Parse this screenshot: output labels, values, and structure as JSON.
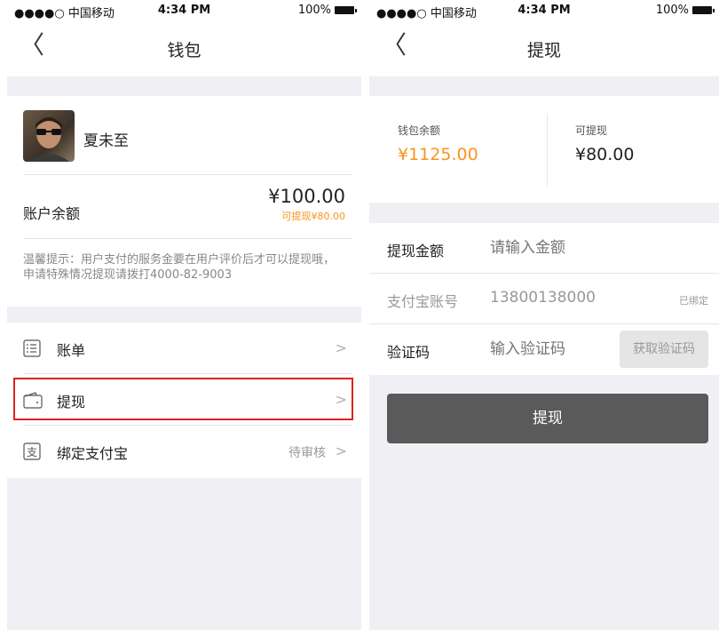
{
  "status": {
    "carrier": "●●●●○ 中国移动",
    "time": "4:34 PM",
    "battery": "100%"
  },
  "wallet": {
    "back": "〈",
    "title": "钱包",
    "user_name": "夏未至",
    "balance_label": "账户余额",
    "balance_value": "¥100.00",
    "withdrawable": "可提现¥80.00",
    "notice": "温馨提示：用户支付的服务金要在用户评价后才可以提现哦，申请特殊情况提现请拨打4000-82-9003",
    "menu": [
      {
        "label": "账单",
        "icon": "bill-list-icon",
        "status": ""
      },
      {
        "label": "提现",
        "icon": "wallet-icon",
        "status": ""
      },
      {
        "label": "绑定支付宝",
        "icon": "alipay-icon",
        "status": "待审核"
      }
    ],
    "arrow": ">",
    "highlight_color": "#e02020"
  },
  "withdraw": {
    "back": "〈",
    "title": "提现",
    "wallet_balance_label": "钱包余额",
    "wallet_balance_value": "¥1125.00",
    "withdrawable_label": "可提现",
    "withdrawable_value": "¥80.00",
    "amount_label": "提现金额",
    "amount_placeholder": "请输入金额",
    "alipay_label": "支付宝账号",
    "alipay_value": "13800138000",
    "alipay_bound": "已绑定",
    "code_label": "验证码",
    "code_placeholder": "输入验证码",
    "get_code": "获取验证码",
    "submit": "提现"
  },
  "colors": {
    "accent_orange": "#f7941d",
    "button_gray": "#5a5a5a",
    "highlight_red": "#e02020"
  }
}
